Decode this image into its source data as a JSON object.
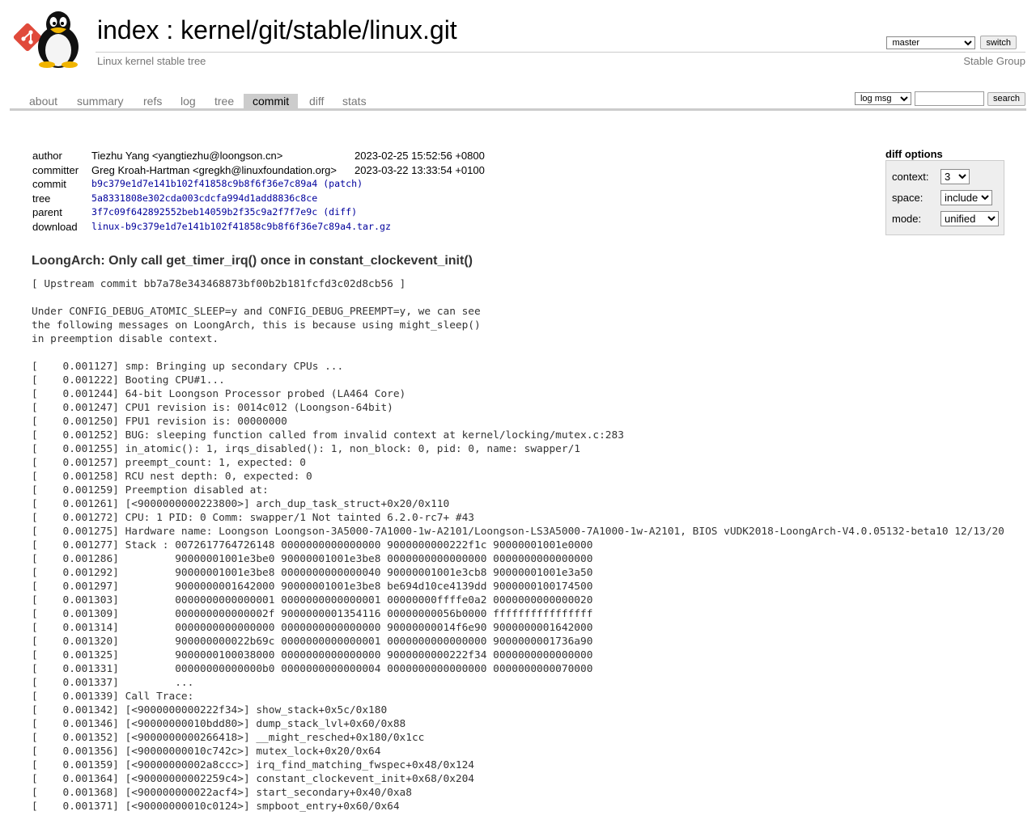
{
  "header": {
    "title_index": "index",
    "title_sep": " : ",
    "title_repo": "kernel/git/stable/linux.git",
    "subtitle": "Linux kernel stable tree",
    "owner": "Stable Group",
    "branch_selected": "master",
    "switch_label": "switch"
  },
  "tabs": [
    {
      "label": "about"
    },
    {
      "label": "summary"
    },
    {
      "label": "refs"
    },
    {
      "label": "log"
    },
    {
      "label": "tree"
    },
    {
      "label": "commit"
    },
    {
      "label": "diff"
    },
    {
      "label": "stats"
    }
  ],
  "active_tab": "commit",
  "search": {
    "scope_selected": "log msg",
    "value": "",
    "button_label": "search"
  },
  "commit_info": {
    "author_label": "author",
    "author": "Tiezhu Yang <yangtiezhu@loongson.cn>",
    "author_date": "2023-02-25 15:52:56 +0800",
    "committer_label": "committer",
    "committer": "Greg Kroah-Hartman <gregkh@linuxfoundation.org>",
    "committer_date": "2023-03-22 13:33:54 +0100",
    "commit_label": "commit",
    "commit_hash": "b9c379e1d7e141b102f41858c9b8f6f36e7c89a4",
    "commit_link": "(patch)",
    "tree_label": "tree",
    "tree_hash": "5a8331808e302cda003cdcfa994d1add8836c8ce",
    "parent_label": "parent",
    "parent_hash": "3f7c09f642892552beb14059b2f35c9a2f7f7e9c",
    "parent_link": "(diff)",
    "download_label": "download",
    "download_file": "linux-b9c379e1d7e141b102f41858c9b8f6f36e7c89a4.tar.gz"
  },
  "diff_options": {
    "title": "diff options",
    "context_label": "context:",
    "context_value": "3",
    "space_label": "space:",
    "space_value": "include",
    "mode_label": "mode:",
    "mode_value": "unified"
  },
  "subject": "LoongArch: Only call get_timer_irq() once in constant_clockevent_init()",
  "message": "[ Upstream commit bb7a78e343468873bf00b2b181fcfd3c02d8cb56 ]\n\nUnder CONFIG_DEBUG_ATOMIC_SLEEP=y and CONFIG_DEBUG_PREEMPT=y, we can see\nthe following messages on LoongArch, this is because using might_sleep()\nin preemption disable context.\n\n[    0.001127] smp: Bringing up secondary CPUs ...\n[    0.001222] Booting CPU#1...\n[    0.001244] 64-bit Loongson Processor probed (LA464 Core)\n[    0.001247] CPU1 revision is: 0014c012 (Loongson-64bit)\n[    0.001250] FPU1 revision is: 00000000\n[    0.001252] BUG: sleeping function called from invalid context at kernel/locking/mutex.c:283\n[    0.001255] in_atomic(): 1, irqs_disabled(): 1, non_block: 0, pid: 0, name: swapper/1\n[    0.001257] preempt_count: 1, expected: 0\n[    0.001258] RCU nest depth: 0, expected: 0\n[    0.001259] Preemption disabled at:\n[    0.001261] [<9000000000223800>] arch_dup_task_struct+0x20/0x110\n[    0.001272] CPU: 1 PID: 0 Comm: swapper/1 Not tainted 6.2.0-rc7+ #43\n[    0.001275] Hardware name: Loongson Loongson-3A5000-7A1000-1w-A2101/Loongson-LS3A5000-7A1000-1w-A2101, BIOS vUDK2018-LoongArch-V4.0.05132-beta10 12/13/20\n[    0.001277] Stack : 0072617764726148 0000000000000000 9000000000222f1c 90000001001e0000\n[    0.001286]         90000001001e3be0 90000001001e3be8 0000000000000000 0000000000000000\n[    0.001292]         90000001001e3be8 0000000000000040 90000001001e3cb8 90000001001e3a50\n[    0.001297]         9000000001642000 90000001001e3be8 be694d10ce4139dd 9000000100174500\n[    0.001303]         0000000000000001 0000000000000001 00000000ffffe0a2 0000000000000020\n[    0.001309]         000000000000002f 9000000001354116 00000000056b0000 ffffffffffffffff\n[    0.001314]         0000000000000000 0000000000000000 90000000014f6e90 9000000001642000\n[    0.001320]         900000000022b69c 0000000000000001 0000000000000000 9000000001736a90\n[    0.001325]         9000000100038000 0000000000000000 9000000000222f34 0000000000000000\n[    0.001331]         00000000000000b0 0000000000000004 0000000000000000 0000000000070000\n[    0.001337]         ...\n[    0.001339] Call Trace:\n[    0.001342] [<9000000000222f34>] show_stack+0x5c/0x180\n[    0.001346] [<90000000010bdd80>] dump_stack_lvl+0x60/0x88\n[    0.001352] [<9000000000266418>] __might_resched+0x180/0x1cc\n[    0.001356] [<90000000010c742c>] mutex_lock+0x20/0x64\n[    0.001359] [<90000000002a8ccc>] irq_find_matching_fwspec+0x48/0x124\n[    0.001364] [<90000000002259c4>] constant_clockevent_init+0x68/0x204\n[    0.001368] [<900000000022acf4>] start_secondary+0x40/0xa8\n[    0.001371] [<90000000010c0124>] smpboot_entry+0x60/0x64",
  "colors": {
    "link": "#00009c",
    "muted": "#777777",
    "tab_active_bg": "#cccccc",
    "logo_red": "#e04a3b"
  },
  "icons": {
    "logo": "git-diamond-logo",
    "mascot": "tux-penguin"
  }
}
